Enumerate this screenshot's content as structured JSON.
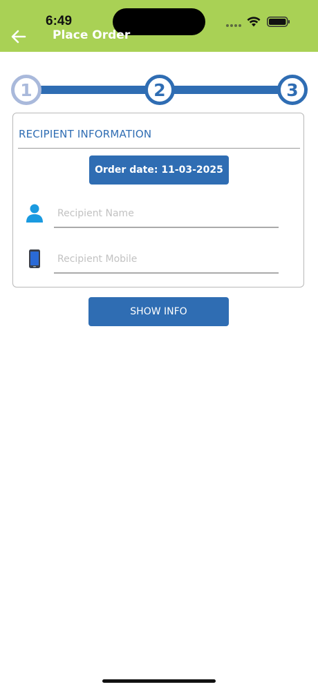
{
  "status_bar": {
    "time": "6:49"
  },
  "header": {
    "title": "Place Order",
    "back_icon": "arrow-left-icon",
    "background_color": "#a9d155"
  },
  "stepper": {
    "steps": [
      {
        "label": "1",
        "state": "done"
      },
      {
        "label": "2",
        "state": "active"
      },
      {
        "label": "3",
        "state": "active"
      }
    ],
    "active_color": "#2f6db3",
    "done_color": "#a9b9db"
  },
  "recipient_card": {
    "title": "RECIPIENT INFORMATION",
    "order_date_label": "Order date: 11-03-2025",
    "name_field": {
      "placeholder": "Recipient Name",
      "value": "",
      "icon": "person-icon"
    },
    "mobile_field": {
      "placeholder": "Recipient Mobile",
      "value": "",
      "icon": "phone-icon"
    }
  },
  "actions": {
    "show_info_label": "SHOW INFO"
  },
  "accent_color": "#2f6db3"
}
